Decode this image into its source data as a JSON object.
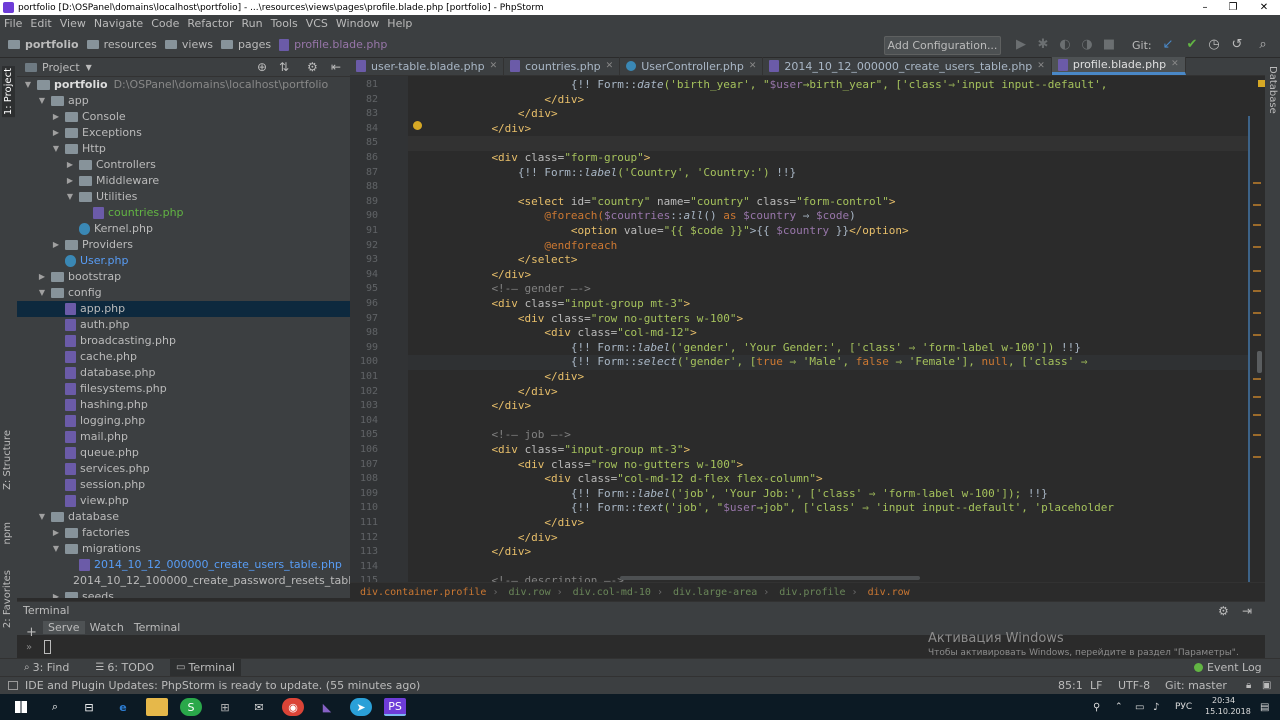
{
  "window": {
    "title": "portfolio [D:\\OSPanel\\domains\\localhost\\portfolio] - ...\\resources\\views\\pages\\profile.blade.php [portfolio] - PhpStorm"
  },
  "menu": [
    "File",
    "Edit",
    "View",
    "Navigate",
    "Code",
    "Refactor",
    "Run",
    "Tools",
    "VCS",
    "Window",
    "Help"
  ],
  "nav": {
    "crumbs": [
      "portfolio",
      "resources",
      "views",
      "pages",
      "profile.blade.php"
    ],
    "add_config": "Add Configuration...",
    "git_label": "Git:"
  },
  "project": {
    "header": "Project",
    "root": "portfolio",
    "root_path": "D:\\OSPanel\\domains\\localhost\\portfolio",
    "tree": [
      {
        "depth": 1,
        "label": "app",
        "kind": "folder",
        "open": true
      },
      {
        "depth": 2,
        "label": "Console",
        "kind": "folder",
        "open": false
      },
      {
        "depth": 2,
        "label": "Exceptions",
        "kind": "folder",
        "open": false
      },
      {
        "depth": 2,
        "label": "Http",
        "kind": "folder",
        "open": true
      },
      {
        "depth": 3,
        "label": "Controllers",
        "kind": "folder",
        "open": false
      },
      {
        "depth": 3,
        "label": "Middleware",
        "kind": "folder",
        "open": false
      },
      {
        "depth": 3,
        "label": "Utilities",
        "kind": "folder",
        "open": true
      },
      {
        "depth": 4,
        "label": "countries.php",
        "kind": "php",
        "color": "green"
      },
      {
        "depth": 3,
        "label": "Kernel.php",
        "kind": "cls"
      },
      {
        "depth": 2,
        "label": "Providers",
        "kind": "folder",
        "open": false
      },
      {
        "depth": 2,
        "label": "User.php",
        "kind": "cls",
        "color": "blue"
      },
      {
        "depth": 1,
        "label": "bootstrap",
        "kind": "folder",
        "open": false
      },
      {
        "depth": 1,
        "label": "config",
        "kind": "folder",
        "open": true
      },
      {
        "depth": 2,
        "label": "app.php",
        "kind": "php",
        "selected": true
      },
      {
        "depth": 2,
        "label": "auth.php",
        "kind": "php"
      },
      {
        "depth": 2,
        "label": "broadcasting.php",
        "kind": "php"
      },
      {
        "depth": 2,
        "label": "cache.php",
        "kind": "php"
      },
      {
        "depth": 2,
        "label": "database.php",
        "kind": "php"
      },
      {
        "depth": 2,
        "label": "filesystems.php",
        "kind": "php"
      },
      {
        "depth": 2,
        "label": "hashing.php",
        "kind": "php"
      },
      {
        "depth": 2,
        "label": "logging.php",
        "kind": "php"
      },
      {
        "depth": 2,
        "label": "mail.php",
        "kind": "php"
      },
      {
        "depth": 2,
        "label": "queue.php",
        "kind": "php"
      },
      {
        "depth": 2,
        "label": "services.php",
        "kind": "php"
      },
      {
        "depth": 2,
        "label": "session.php",
        "kind": "php"
      },
      {
        "depth": 2,
        "label": "view.php",
        "kind": "php"
      },
      {
        "depth": 1,
        "label": "database",
        "kind": "folder",
        "open": true
      },
      {
        "depth": 2,
        "label": "factories",
        "kind": "folder",
        "open": false
      },
      {
        "depth": 2,
        "label": "migrations",
        "kind": "folder",
        "open": true
      },
      {
        "depth": 3,
        "label": "2014_10_12_000000_create_users_table.php",
        "kind": "php",
        "color": "blue"
      },
      {
        "depth": 3,
        "label": "2014_10_12_100000_create_password_resets_table.p",
        "kind": "php"
      },
      {
        "depth": 2,
        "label": "seeds",
        "kind": "folder",
        "open": false
      }
    ]
  },
  "tabs": [
    "user-table.blade.php",
    "countries.php",
    "UserController.php",
    "2014_10_12_000000_create_users_table.php",
    "profile.blade.php"
  ],
  "active_tab": "profile.blade.php",
  "code": [
    {
      "n": "81",
      "i": 12,
      "t": [
        [
          "{!! ",
          "c-txt"
        ],
        [
          "Form",
          "c-txt"
        ],
        [
          "::",
          "c-txt"
        ],
        [
          "date",
          "c-fn"
        ],
        [
          "('birth_year', \"",
          "c-str"
        ],
        [
          "$user",
          "c-var"
        ],
        [
          "→birth_year\", ['class'⇒'input input--default',",
          "c-str"
        ]
      ]
    },
    {
      "n": "82",
      "i": 10,
      "t": [
        [
          "</div>",
          "c-tag"
        ]
      ]
    },
    {
      "n": "83",
      "i": 8,
      "t": [
        [
          "</div>",
          "c-tag"
        ]
      ]
    },
    {
      "n": "84",
      "i": 6,
      "t": [
        [
          "</div>",
          "c-tag"
        ]
      ]
    },
    {
      "n": "85",
      "i": 0,
      "t": []
    },
    {
      "n": "86",
      "i": 6,
      "t": [
        [
          "<div ",
          "c-tag"
        ],
        [
          "class=",
          "c-attr"
        ],
        [
          "\"form-group\"",
          "c-str"
        ],
        [
          ">",
          "c-tag"
        ]
      ]
    },
    {
      "n": "87",
      "i": 8,
      "t": [
        [
          "{!! Form::",
          "c-txt"
        ],
        [
          "label",
          "c-fn"
        ],
        [
          "('Country', 'Country:') ",
          "c-str"
        ],
        [
          "!!}",
          "c-txt"
        ]
      ]
    },
    {
      "n": "88",
      "i": 0,
      "t": []
    },
    {
      "n": "89",
      "i": 8,
      "t": [
        [
          "<select ",
          "c-tag"
        ],
        [
          "id=",
          "c-attr"
        ],
        [
          "\"country\" ",
          "c-str"
        ],
        [
          "name=",
          "c-attr"
        ],
        [
          "\"country\" ",
          "c-str"
        ],
        [
          "class=",
          "c-attr"
        ],
        [
          "\"form-control\"",
          "c-str"
        ],
        [
          ">",
          "c-tag"
        ]
      ]
    },
    {
      "n": "90",
      "i": 10,
      "t": [
        [
          "@foreach(",
          "c-kw"
        ],
        [
          "$countries",
          "c-var"
        ],
        [
          "::",
          "c-txt"
        ],
        [
          "all",
          "c-fn"
        ],
        [
          "() ",
          "c-txt"
        ],
        [
          "as ",
          "c-kw"
        ],
        [
          "$country ",
          "c-var"
        ],
        [
          "⇒ ",
          "c-txt"
        ],
        [
          "$code",
          "c-var"
        ],
        [
          ")",
          "c-txt"
        ]
      ]
    },
    {
      "n": "91",
      "i": 12,
      "t": [
        [
          "<option ",
          "c-tag"
        ],
        [
          "value=",
          "c-attr"
        ],
        [
          "\"{{ $code }}\"",
          "c-str"
        ],
        [
          ">{{ ",
          "c-txt"
        ],
        [
          "$country",
          "c-var"
        ],
        [
          " }}",
          "c-txt"
        ],
        [
          "</option>",
          "c-tag"
        ]
      ]
    },
    {
      "n": "92",
      "i": 10,
      "t": [
        [
          "@endforeach",
          "c-kw"
        ]
      ]
    },
    {
      "n": "93",
      "i": 8,
      "t": [
        [
          "</select>",
          "c-tag"
        ]
      ]
    },
    {
      "n": "94",
      "i": 6,
      "t": [
        [
          "</div>",
          "c-tag"
        ]
      ]
    },
    {
      "n": "95",
      "i": 6,
      "t": [
        [
          "<!-— gender —->",
          "c-com"
        ]
      ]
    },
    {
      "n": "96",
      "i": 6,
      "t": [
        [
          "<div ",
          "c-tag"
        ],
        [
          "class=",
          "c-attr"
        ],
        [
          "\"input-group mt-3\"",
          "c-str"
        ],
        [
          ">",
          "c-tag"
        ]
      ]
    },
    {
      "n": "97",
      "i": 8,
      "t": [
        [
          "<div ",
          "c-tag"
        ],
        [
          "class=",
          "c-attr"
        ],
        [
          "\"row no-gutters w-100\"",
          "c-str"
        ],
        [
          ">",
          "c-tag"
        ]
      ]
    },
    {
      "n": "98",
      "i": 10,
      "t": [
        [
          "<div ",
          "c-tag"
        ],
        [
          "class=",
          "c-attr"
        ],
        [
          "\"col-md-12\"",
          "c-str"
        ],
        [
          ">",
          "c-tag"
        ]
      ]
    },
    {
      "n": "99",
      "i": 12,
      "t": [
        [
          "{!! Form::",
          "c-txt"
        ],
        [
          "label",
          "c-fn"
        ],
        [
          "('gender', 'Your Gender:', ['class' ⇒ 'form-label w-100']) ",
          "c-str"
        ],
        [
          "!!}",
          "c-txt"
        ]
      ]
    },
    {
      "n": "100",
      "i": 12,
      "t": [
        [
          "{!! Form::",
          "c-txt"
        ],
        [
          "select",
          "c-fn"
        ],
        [
          "('gender', [",
          "c-str"
        ],
        [
          "true ",
          "c-kw"
        ],
        [
          "⇒ 'Male', ",
          "c-str"
        ],
        [
          "false ",
          "c-kw"
        ],
        [
          "⇒ 'Female'], ",
          "c-str"
        ],
        [
          "null",
          "c-kw"
        ],
        [
          ", ['class' ⇒",
          "c-str"
        ]
      ]
    },
    {
      "n": "101",
      "i": 10,
      "t": [
        [
          "</div>",
          "c-tag"
        ]
      ]
    },
    {
      "n": "102",
      "i": 8,
      "t": [
        [
          "</div>",
          "c-tag"
        ]
      ]
    },
    {
      "n": "103",
      "i": 6,
      "t": [
        [
          "</div>",
          "c-tag"
        ]
      ]
    },
    {
      "n": "104",
      "i": 0,
      "t": []
    },
    {
      "n": "105",
      "i": 6,
      "t": [
        [
          "<!-— job —->",
          "c-com"
        ]
      ]
    },
    {
      "n": "106",
      "i": 6,
      "t": [
        [
          "<div ",
          "c-tag"
        ],
        [
          "class=",
          "c-attr"
        ],
        [
          "\"input-group mt-3\"",
          "c-str"
        ],
        [
          ">",
          "c-tag"
        ]
      ]
    },
    {
      "n": "107",
      "i": 8,
      "t": [
        [
          "<div ",
          "c-tag"
        ],
        [
          "class=",
          "c-attr"
        ],
        [
          "\"row no-gutters w-100\"",
          "c-str"
        ],
        [
          ">",
          "c-tag"
        ]
      ]
    },
    {
      "n": "108",
      "i": 10,
      "t": [
        [
          "<div ",
          "c-tag"
        ],
        [
          "class=",
          "c-attr"
        ],
        [
          "\"col-md-12 d-flex flex-column\"",
          "c-str"
        ],
        [
          ">",
          "c-tag"
        ]
      ]
    },
    {
      "n": "109",
      "i": 12,
      "t": [
        [
          "{!! Form::",
          "c-txt"
        ],
        [
          "label",
          "c-fn"
        ],
        [
          "('job', 'Your Job:', ['class' ⇒ 'form-label w-100']); ",
          "c-str"
        ],
        [
          "!!}",
          "c-txt"
        ]
      ]
    },
    {
      "n": "110",
      "i": 12,
      "t": [
        [
          "{!! Form::",
          "c-txt"
        ],
        [
          "text",
          "c-fn"
        ],
        [
          "('job', \"",
          "c-str"
        ],
        [
          "$user",
          "c-var"
        ],
        [
          "→job\", ['class' ⇒ 'input input--default', 'placeholder",
          "c-str"
        ]
      ]
    },
    {
      "n": "111",
      "i": 10,
      "t": [
        [
          "</div>",
          "c-tag"
        ]
      ]
    },
    {
      "n": "112",
      "i": 8,
      "t": [
        [
          "</div>",
          "c-tag"
        ]
      ]
    },
    {
      "n": "113",
      "i": 6,
      "t": [
        [
          "</div>",
          "c-tag"
        ]
      ]
    },
    {
      "n": "114",
      "i": 0,
      "t": []
    },
    {
      "n": "115",
      "i": 6,
      "t": [
        [
          "<!-— description —->",
          "c-com"
        ]
      ]
    }
  ],
  "editor_breadcrumbs": [
    "div.container.profile",
    "div.row",
    "div.col-md-10",
    "div.large-area",
    "div.profile",
    "div.row"
  ],
  "terminal": {
    "title": "Terminal",
    "tabs": [
      "Serve",
      "Watch",
      "Terminal"
    ]
  },
  "bottom_tools": {
    "find": "3: Find",
    "todo": "6: TODO",
    "terminal": "Terminal",
    "event_log": "Event Log"
  },
  "status": {
    "message": "IDE and Plugin Updates: PhpStorm is ready to update. (55 minutes ago)",
    "position": "85:1",
    "lf": "LF",
    "encoding": "UTF-8",
    "git": "Git: master"
  },
  "windows_activation": {
    "title": "Активация Windows",
    "sub": "Чтобы активировать Windows, перейдите в раздел \"Параметры\"."
  },
  "side_labels": {
    "project": "1: Project",
    "structure": "Z: Structure",
    "npm": "npm",
    "favorites": "2: Favorites",
    "database": "Database"
  },
  "taskbar": {
    "lang": "РУС",
    "time": "20:34",
    "date": "15.10.2018"
  }
}
